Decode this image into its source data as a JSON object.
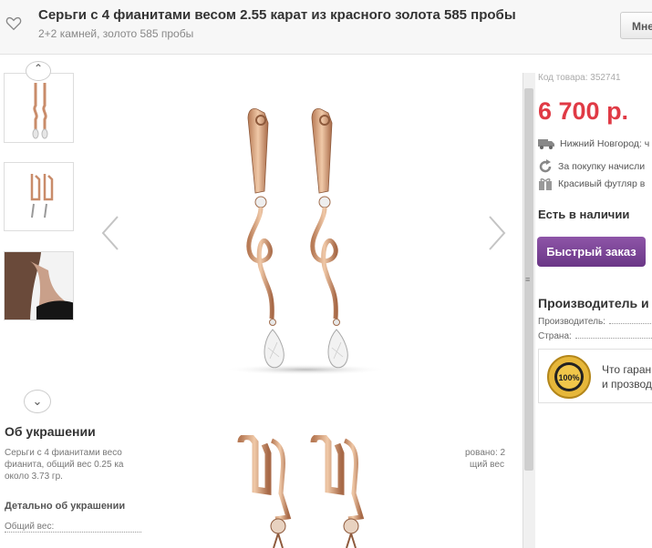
{
  "header": {
    "title": "Серьги с 4 фианитами весом 2.55 карат из красного золота 585 пробы",
    "subtitle": "2+2 камней, золото 585 пробы",
    "menu_label": "Мне"
  },
  "gallery": {
    "prev_icon": "chevron-left-icon",
    "next_icon": "chevron-right-icon"
  },
  "about": {
    "title": "Об украшении",
    "text_line1": "Серьги с 4 фианитами весо",
    "text_line1_right": "ровано: 2",
    "text_line2": "фианита, общий вес 0.25 ка",
    "text_line2_right": "щий вес",
    "text_line3": "около 3.73 гр.",
    "detail_title": "Детально об украшении",
    "weight_label": "Общий вес:"
  },
  "product": {
    "sku": "Код товара: 352741",
    "price": "6 700 р.",
    "delivery": "Нижний Новгород: ч",
    "bonus": "За покупку начисли",
    "gift": "Красивый футляр в",
    "stock": "Есть в наличии",
    "buy_button": "Быстрый заказ"
  },
  "maker": {
    "title": "Производитель и",
    "producer_label": "Производитель:",
    "country_label": "Страна:",
    "guarantee_line1": "Что гаран",
    "guarantee_line2": "и прозвод"
  },
  "colors": {
    "price": "#e03a45",
    "button": "#7a4494",
    "gold": "#d4a07a"
  }
}
